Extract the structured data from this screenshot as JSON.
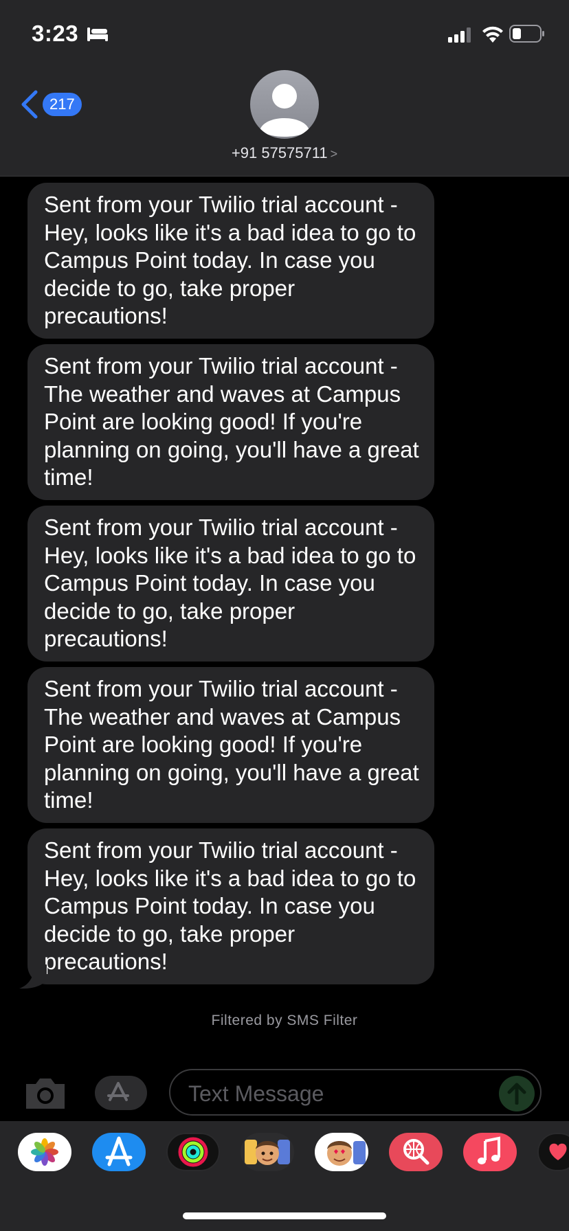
{
  "status_bar": {
    "time": "3:23",
    "icons": [
      "bed-icon",
      "signal-icon",
      "wifi-icon",
      "battery-icon"
    ]
  },
  "header": {
    "back_badge": "217",
    "contact_name": "+91 57575711",
    "contact_chevron": ">"
  },
  "messages": [
    {
      "sender": "received",
      "text": "Sent from your Twilio trial account - Hey, looks like it's a bad idea to go to Campus Point today. In case you decide to go, take proper precautions!"
    },
    {
      "sender": "received",
      "text": "Sent from your Twilio trial account - The weather and waves at Campus Point are looking good! If you're planning on going, you'll have a great time!"
    },
    {
      "sender": "received",
      "text": "Sent from your Twilio trial account - Hey, looks like it's a bad idea to go to Campus Point today. In case you decide to go, take proper precautions!"
    },
    {
      "sender": "received",
      "text": "Sent from your Twilio trial account - The weather and waves at Campus Point are looking good! If you're planning on going, you'll have a great time!"
    },
    {
      "sender": "received",
      "text": "Sent from your Twilio trial account - Hey, looks like it's a bad idea to go to Campus Point today. In case you decide to go, take proper precautions!"
    }
  ],
  "filter_note": "Filtered by SMS Filter",
  "compose": {
    "placeholder": "Text Message"
  },
  "app_drawer": {
    "apps": [
      "photos-icon",
      "app-store-icon",
      "activity-icon",
      "memoji-icon",
      "animoji-icon",
      "image-search-icon",
      "music-icon",
      "digital-touch-icon"
    ]
  },
  "colors": {
    "accent": "#3478f6",
    "bubble": "#262628",
    "background": "#000000"
  }
}
